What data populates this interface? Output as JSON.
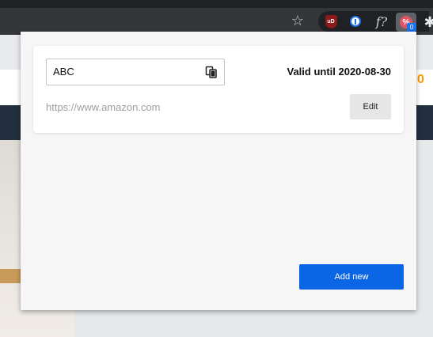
{
  "toolbar": {
    "extensions": [
      {
        "name": "bookmark-star-icon",
        "glyph": "☆"
      },
      {
        "name": "ublock-origin-icon",
        "glyph": "uD"
      },
      {
        "name": "password-manager-icon",
        "glyph": "1"
      },
      {
        "name": "font-finder-icon",
        "glyph": "f?"
      },
      {
        "name": "coupon-extension-icon",
        "glyph": "%"
      },
      {
        "name": "extensions-puzzle-icon",
        "glyph": "✱"
      }
    ],
    "badge_count": "0"
  },
  "background_page": {
    "cart_count_fragment": "0"
  },
  "coupon": {
    "code": "ABC",
    "valid_until": "Valid until 2020-08-30",
    "site": "https://www.amazon.com",
    "edit_label": "Edit"
  },
  "actions": {
    "add_new_label": "Add new"
  },
  "colors": {
    "primary_button": "#0a66e4",
    "badge": "#1a73e8",
    "ext_icon": "#e25564"
  }
}
